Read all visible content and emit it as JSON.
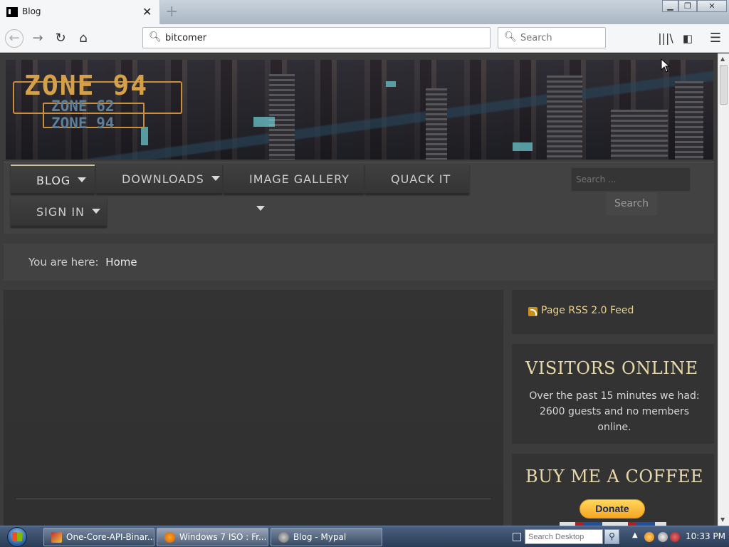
{
  "browser": {
    "tab_title": "Blog",
    "tab_close": "✕",
    "new_tab": "+",
    "address_value": "bitcomer",
    "search_placeholder": "Search",
    "window_buttons": {
      "minimize": "▁",
      "maximize": "❐",
      "close": "✕"
    }
  },
  "site": {
    "logo": {
      "main": "ZONE 94",
      "sub1": "ZONE 62",
      "sub2": "ZONE 94"
    },
    "nav": {
      "items": [
        {
          "label": "BLOG",
          "active": true,
          "dropdown": true
        },
        {
          "label": "DOWNLOADS",
          "active": false,
          "dropdown": true
        },
        {
          "label": "IMAGE GALLERY",
          "active": false,
          "dropdown": true
        },
        {
          "label": "QUACK IT",
          "active": false,
          "dropdown": false
        },
        {
          "label": "SIGN IN",
          "active": false,
          "dropdown": true
        }
      ],
      "search_placeholder": "Search ...",
      "search_button": "Search"
    },
    "breadcrumb": {
      "lead": "You are here:",
      "current": "Home"
    },
    "sidebar": {
      "rss": "Page RSS 2.0 Feed",
      "visitors": {
        "title": "VISITORS ONLINE",
        "text": "Over the past 15 minutes we had: 2600 guests and no members online."
      },
      "coffee": {
        "title": "BUY ME A COFFEE",
        "donate": "Donate"
      }
    }
  },
  "taskbar": {
    "items": [
      {
        "label": "One-Core-API-Binar..."
      },
      {
        "label": "Windows 7 ISO : Fr..."
      },
      {
        "label": "Blog - Mypal"
      }
    ],
    "desktop_search_placeholder": "Search Desktop",
    "clock": "10:33 PM"
  },
  "colors": {
    "accent_gold": "#e9d08d",
    "page_bg": "#3c3c3c",
    "panel_bg": "#333333",
    "donate_yellow": "#f5a623"
  }
}
